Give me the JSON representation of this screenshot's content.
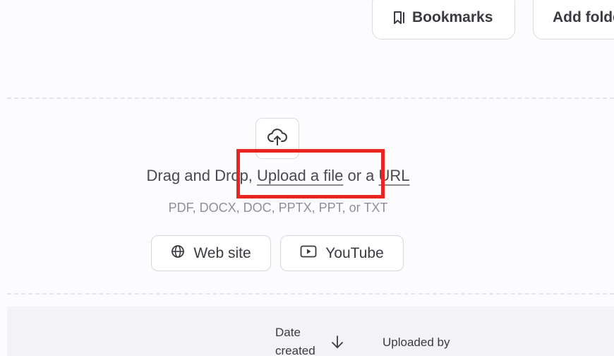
{
  "toolbar": {
    "bookmarks_label": "Bookmarks",
    "add_folder_label": "Add folde"
  },
  "upload": {
    "drag_text": "Drag and Drop, ",
    "upload_link": "Upload a file",
    "or_text": " or a ",
    "url_link": "URL",
    "formats": "PDF, DOCX, DOC, PPTX, PPT, or TXT"
  },
  "sources": {
    "website_label": "Web site",
    "youtube_label": "YouTube"
  },
  "table": {
    "col_date_line1": "Date",
    "col_date_line2": "created",
    "col_uploaded_by": "Uploaded by"
  },
  "icons": {
    "bookmark": "bookmark-icon",
    "upload": "cloud-upload-icon",
    "globe": "globe-icon",
    "youtube": "play-icon",
    "sort": "arrow-down-icon"
  },
  "colors": {
    "highlight": "#e8251e",
    "border": "#dcdadf",
    "header_bg": "#f3f2f5"
  }
}
